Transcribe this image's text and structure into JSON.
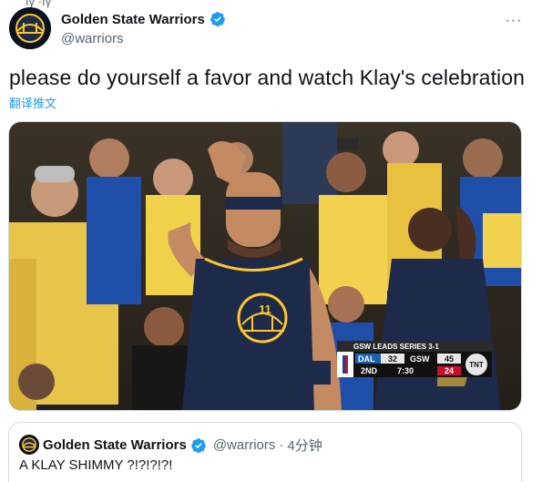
{
  "tweet": {
    "display_name": "Golden State Warriors",
    "handle": "@warriors",
    "text": "please do yourself a favor and watch Klay's celebration",
    "translate_label": "翻译推文",
    "more_label": "···"
  },
  "scoreboard": {
    "series_text": "GSW LEADS SERIES 3-1",
    "team1": "DAL",
    "score1": "32",
    "team2": "GSW",
    "score2": "45",
    "quarter": "2ND",
    "clock": "7:30",
    "shot_clock": "24",
    "network": "TNT"
  },
  "player": {
    "jersey_number": "11"
  },
  "quote": {
    "display_name": "Golden State Warriors",
    "handle": "@warriors",
    "separator": "·",
    "time": "4分钟",
    "text": "A KLAY SHIMMY ?!?!?!?!"
  },
  "colors": {
    "verified": "#1d9bf0",
    "link": "#1d9bf0",
    "warriors_gold": "#ffc72c",
    "warriors_navy": "#1d2a4a"
  },
  "icons": [
    "warriors-logo-icon",
    "verified-badge-icon",
    "more-icon",
    "nba-logo-icon",
    "tnt-logo-icon"
  ]
}
